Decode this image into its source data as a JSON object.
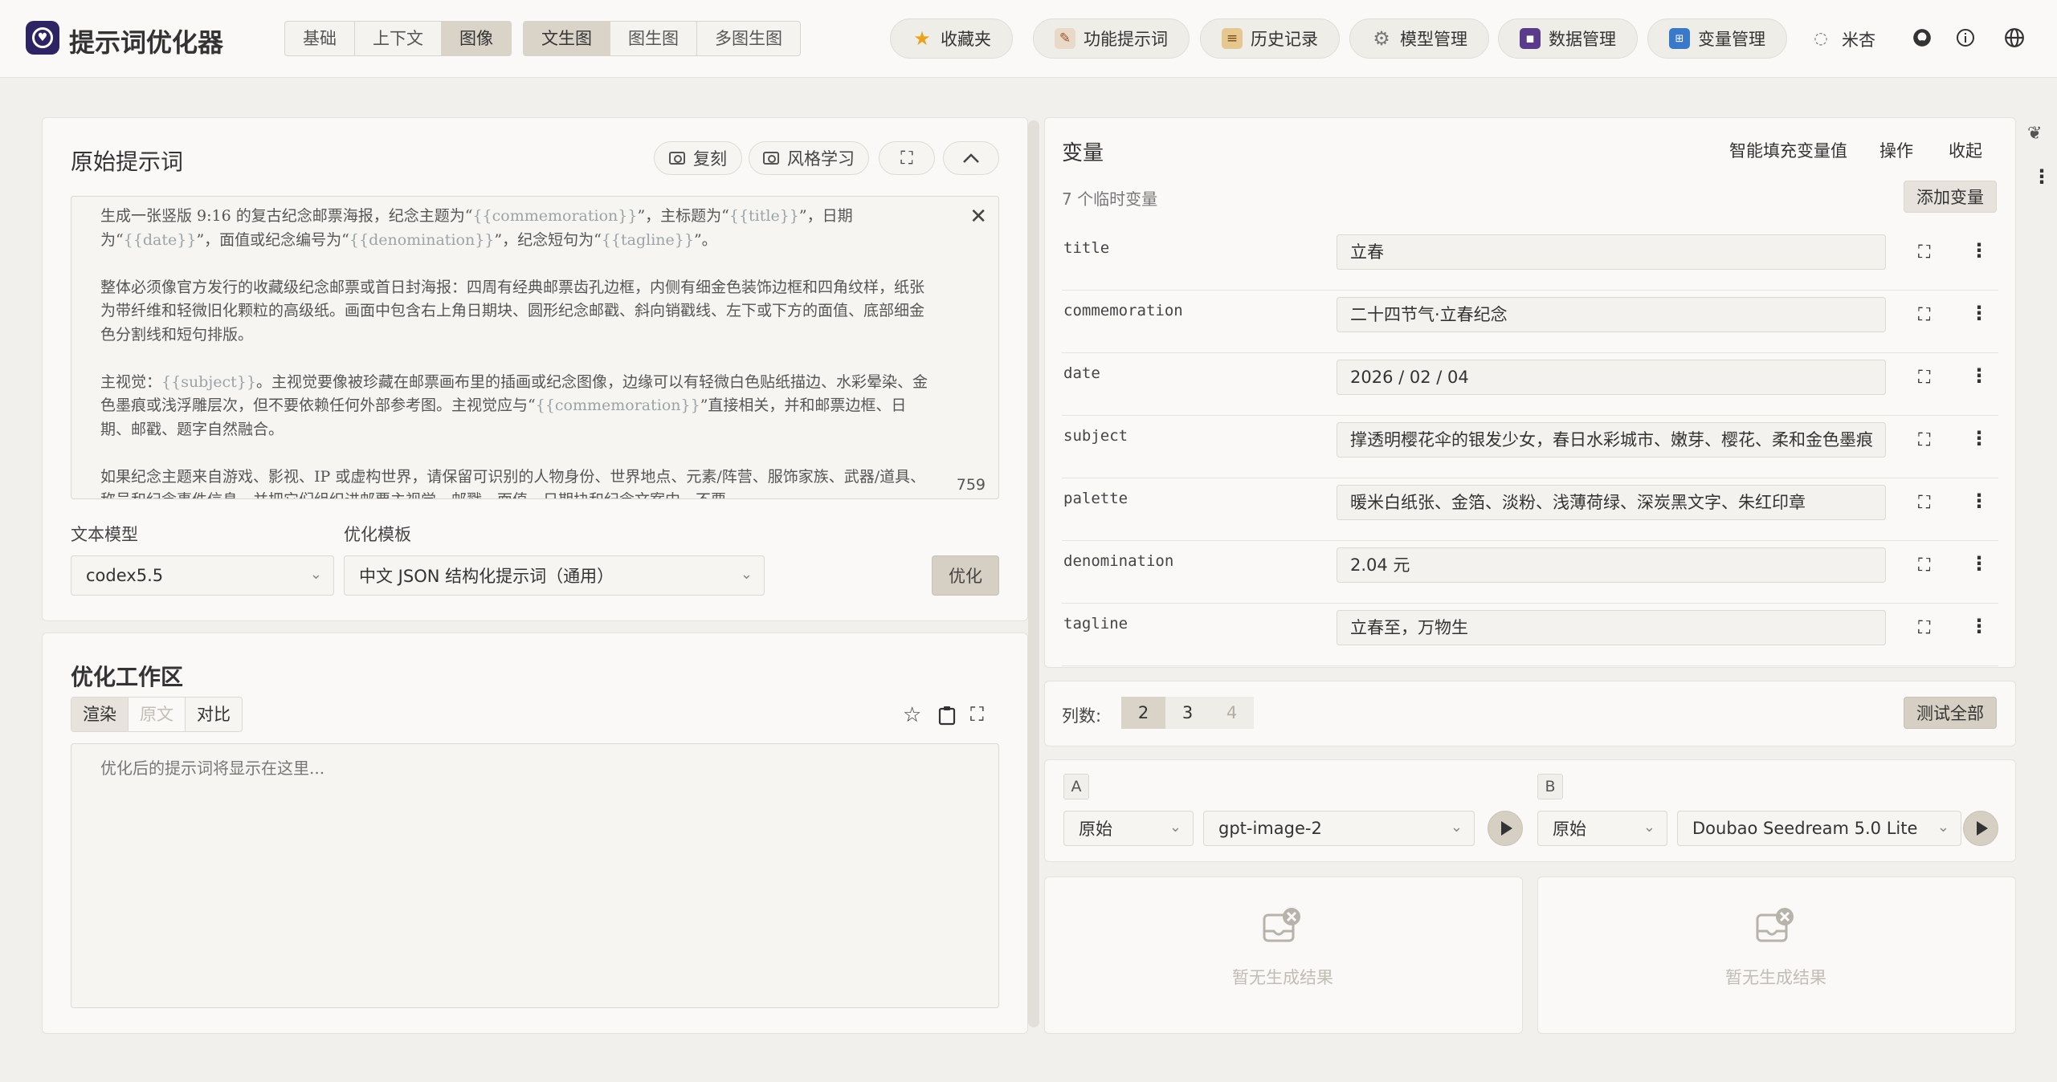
{
  "app": {
    "title": "提示词优化器"
  },
  "mode_tabs": [
    "基础",
    "上下文",
    "图像"
  ],
  "gen_tabs": [
    "文生图",
    "图生图",
    "多图生图"
  ],
  "nav": {
    "favorites": "收藏夹",
    "function_prompts": "功能提示词",
    "history": "历史记录",
    "model_mgmt": "模型管理",
    "data_mgmt": "数据管理",
    "variable_mgmt": "变量管理",
    "user": "米杏"
  },
  "original": {
    "title": "原始提示词",
    "copy_btn": "复刻",
    "style_btn": "风格学习",
    "char_count": "759",
    "p1a": "生成一张竖版 9:16 的复古纪念邮票海报，纪念主题为“",
    "v_commemoration": "{{commemoration}}",
    "p1b": "”，主标题为“",
    "v_title": "{{title}}",
    "p1c": "”，日期为“",
    "v_date": "{{date}}",
    "p1d": "”，面值或纪念编号为“",
    "v_denomination": "{{denomination}}",
    "p1e": "”，纪念短句为“",
    "v_tagline": "{{tagline}}",
    "p1f": "”。",
    "p2": "整体必须像官方发行的收藏级纪念邮票或首日封海报：四周有经典邮票齿孔边框，内侧有细金色装饰边框和四角纹样，纸张为带纤维和轻微旧化颗粒的高级纸。画面中包含右上角日期块、圆形纪念邮戳、斜向销戳线、左下或下方的面值、底部细金色分割线和短句排版。",
    "p3a": "主视觉：",
    "v_subject": "{{subject}}",
    "p3b": "。主视觉要像被珍藏在邮票画布里的插画或纪念图像，边缘可以有轻微白色贴纸描边、水彩晕染、金色墨痕或浅浮雕层次，但不要依赖任何外部参考图。主视觉应与“",
    "v_commemoration2": "{{commemoration}}",
    "p3c": "”直接相关，并和邮票边框、日期、邮戳、题字自然融合。",
    "p4": "如果纪念主题来自游戏、影视、IP 或虚构世界，请保留可识别的人物身份、世界地点、元素/阵营、服饰家族、武器/道具、称号和纪念事件信息，并把它们组织进邮票主视觉、邮戳、面值、日期块和纪念文案中。不要"
  },
  "model_select": {
    "label": "文本模型",
    "value": "codex5.5"
  },
  "template_select": {
    "label": "优化模板",
    "value": "中文 JSON 结构化提示词（通用）"
  },
  "optimize_btn": "优化",
  "workspace": {
    "title": "优化工作区",
    "tabs": [
      "渲染",
      "原文",
      "对比"
    ],
    "placeholder": "优化后的提示词将显示在这里..."
  },
  "variables": {
    "title": "变量",
    "smart_fill": "智能填充变量值",
    "ops": "操作",
    "collapse": "收起",
    "count_label": "7 个临时变量",
    "add_btn": "添加变量",
    "items": [
      {
        "name": "title",
        "value": "立春"
      },
      {
        "name": "commemoration",
        "value": "二十四节气·立春纪念"
      },
      {
        "name": "date",
        "value": "2026 / 02 / 04"
      },
      {
        "name": "subject",
        "value": "撑透明樱花伞的银发少女，春日水彩城市、嫩芽、樱花、柔和金色墨痕"
      },
      {
        "name": "palette",
        "value": "暖米白纸张、金箔、淡粉、浅薄荷绿、深炭黑文字、朱红印章"
      },
      {
        "name": "denomination",
        "value": "2.04 元"
      },
      {
        "name": "tagline",
        "value": "立春至，万物生"
      }
    ]
  },
  "columns": {
    "label": "列数:",
    "options": [
      "2",
      "3",
      "4"
    ],
    "test_all": "测试全部"
  },
  "compare": {
    "a": {
      "tag": "A",
      "mode": "原始",
      "model": "gpt-image-2",
      "empty": "暂无生成结果"
    },
    "b": {
      "tag": "B",
      "mode": "原始",
      "model": "Doubao Seedream 5.0 Lite",
      "empty": "暂无生成结果"
    }
  }
}
